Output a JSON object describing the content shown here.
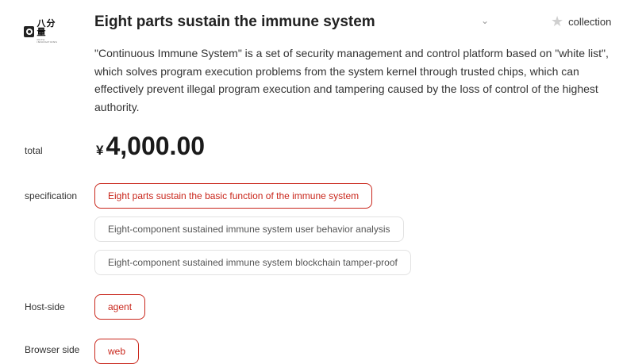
{
  "logo": {
    "cn": "八分量",
    "en": "OCTA INNOVATIONS"
  },
  "product": {
    "title": "Eight parts sustain the immune system",
    "collection_label": "collection",
    "description": "\"Continuous Immune System\" is a set of security management and control platform based on \"white list\", which solves program execution problems from the system kernel through trusted chips, which can effectively prevent illegal program execution and tampering caused by the loss of control of the highest authority."
  },
  "price": {
    "label": "total",
    "currency": "¥",
    "amount": "4,000.00"
  },
  "specification": {
    "label": "specification",
    "options": [
      {
        "label": "Eight parts sustain the basic function of the immune system",
        "selected": true
      },
      {
        "label": "Eight-component sustained immune system user behavior analysis",
        "selected": false
      },
      {
        "label": "Eight-component sustained immune system blockchain tamper-proof",
        "selected": false
      }
    ]
  },
  "host_side": {
    "label": "Host-side",
    "options": [
      {
        "label": "agent",
        "selected": true
      }
    ]
  },
  "browser_side": {
    "label": "Browser side",
    "options": [
      {
        "label": "web",
        "selected": true
      }
    ]
  },
  "colors": {
    "accent": "#c9261b",
    "border": "#e2e2e2",
    "text": "#333333"
  },
  "icons": {
    "collection": "star-icon",
    "dropdown": "chevron-down-icon"
  }
}
